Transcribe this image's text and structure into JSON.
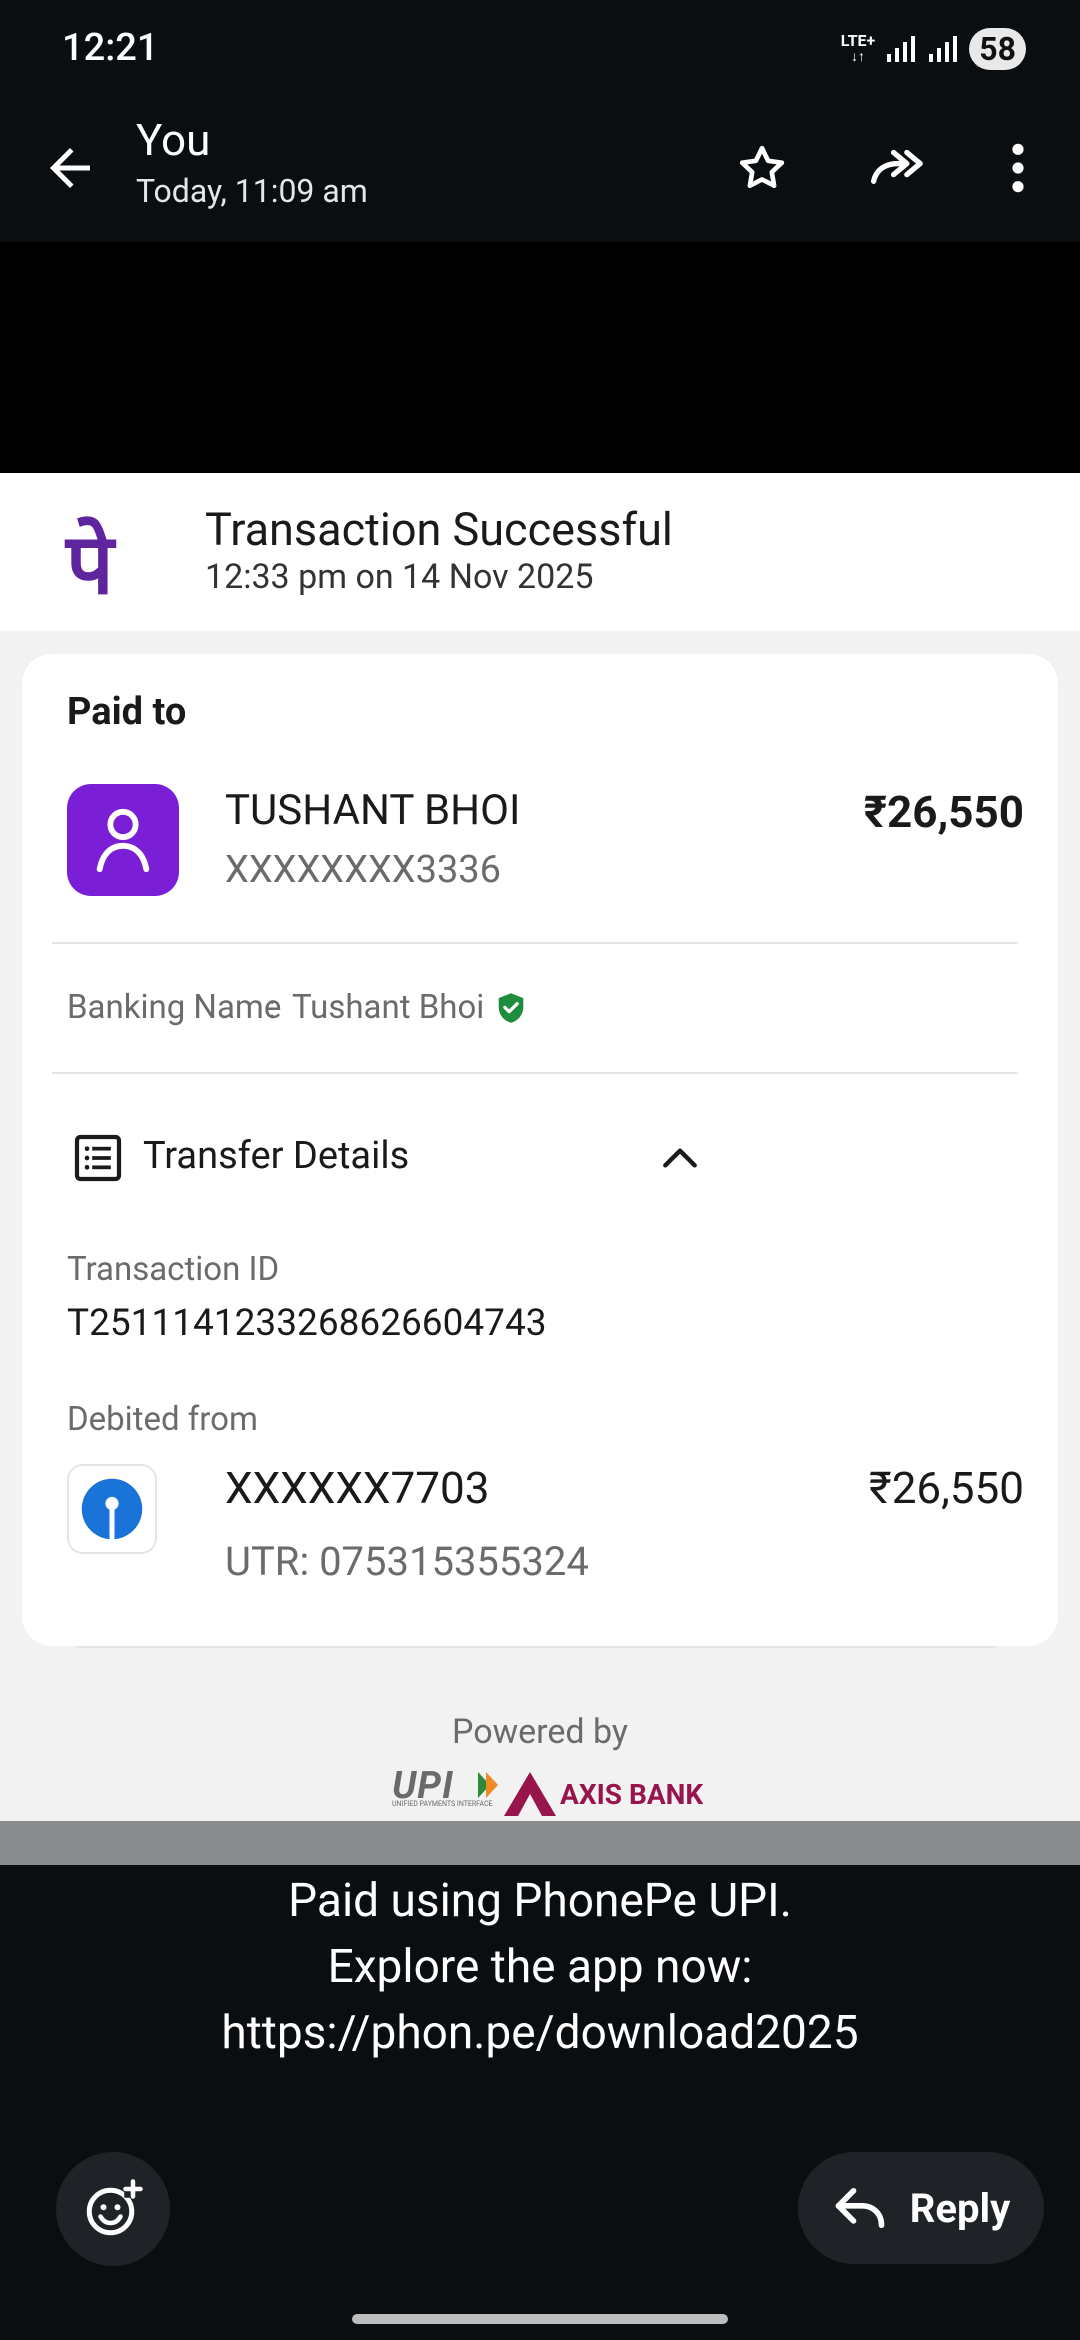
{
  "status_bar": {
    "time": "12:21",
    "network": "LTE+",
    "battery": "58"
  },
  "header": {
    "title": "You",
    "subtitle": "Today, 11:09 am"
  },
  "receipt": {
    "status_title": "Transaction Successful",
    "datetime": "12:33 pm on 14 Nov 2025",
    "paid_to_label": "Paid to",
    "payee_name": "TUSHANT BHOI",
    "payee_account": "XXXXXXXX3336",
    "amount": "₹26,550",
    "banking_name_label": "Banking Name",
    "banking_name_sep": ":",
    "banking_name_value": "Tushant Bhoi",
    "transfer_details_label": "Transfer Details",
    "transaction_id_label": "Transaction ID",
    "transaction_id": "T2511141233268626604743",
    "debited_from_label": "Debited from",
    "debit_account": "XXXXXX7703",
    "debit_amount": "₹26,550",
    "utr": "UTR: 075315355324",
    "powered_by": "Powered by",
    "upi_logo": "UPI",
    "upi_tagline": "UNIFIED PAYMENTS INTERFACE",
    "bank_logo": "AXIS BANK"
  },
  "message": {
    "line1": "Paid using PhonePe UPI.",
    "line2": "Explore the app now:",
    "line3": "https://phon.pe/download2025"
  },
  "actions": {
    "reply_label": "Reply"
  },
  "colors": {
    "phonepe_purple": "#5f259f",
    "avatar_purple": "#7a1fd6",
    "verified_green": "#1e8e3e",
    "sbi_blue": "#1a73d9",
    "axis_maroon": "#97144d"
  }
}
